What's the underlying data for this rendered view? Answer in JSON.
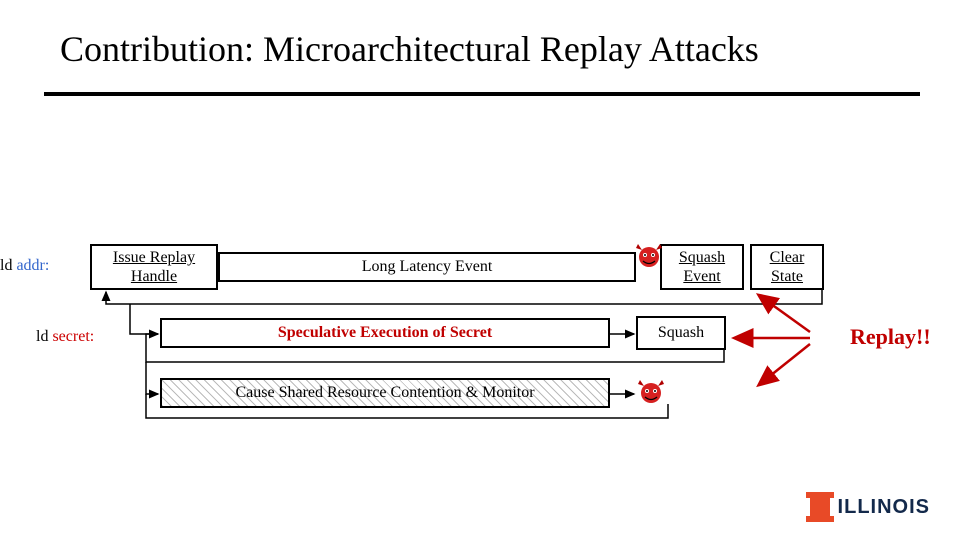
{
  "title": "Contribution: Microarchitectural Replay Attacks",
  "labels": {
    "ld1_prefix": "ld ",
    "ld1_var": "addr:",
    "ld2_prefix": "ld ",
    "ld2_var": "secret:"
  },
  "boxes": {
    "issue": "Issue Replay Handle",
    "long_latency": "Long Latency Event",
    "squash_event": "Squash Event",
    "clear_state": "Clear State",
    "spec_exec": "Speculative Execution of Secret",
    "squash": "Squash",
    "contention": "Cause Shared Resource Contention & Monitor"
  },
  "replay": "Replay!!",
  "logo": "ILLINOIS"
}
